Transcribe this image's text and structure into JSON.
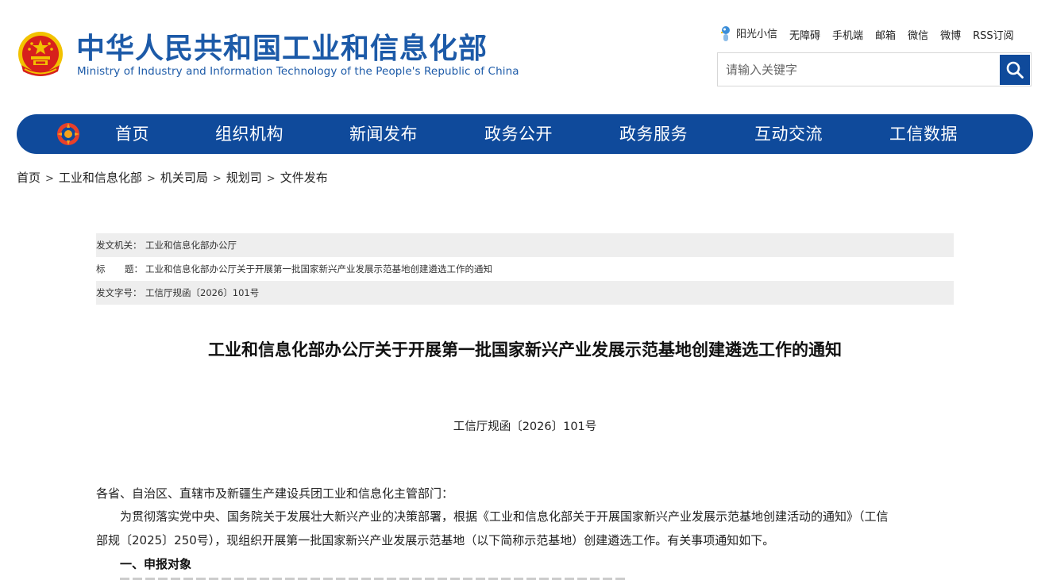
{
  "header": {
    "title": "中华人民共和国工业和信息化部",
    "subtitle": "Ministry of Industry and Information Technology of the People's Republic of China",
    "emblem_icon": "national-emblem-icon",
    "top_links": [
      {
        "label": "阳光小信",
        "icon": "sunshine-mascot-icon"
      },
      {
        "label": "无障碍"
      },
      {
        "label": "手机端"
      },
      {
        "label": "邮箱"
      },
      {
        "label": "微信"
      },
      {
        "label": "微博"
      },
      {
        "label": "RSS订阅"
      }
    ],
    "search": {
      "placeholder": "请输入关键字",
      "icon": "search-icon"
    }
  },
  "nav": {
    "logo_icon": "ministry-logo-icon",
    "items": [
      "首页",
      "组织机构",
      "新闻发布",
      "政务公开",
      "政务服务",
      "互动交流",
      "工信数据"
    ]
  },
  "breadcrumb": [
    "首页",
    "工业和信息化部",
    "机关司局",
    "规划司",
    "文件发布"
  ],
  "meta": {
    "issuer_key": "发文机关：",
    "issuer": "工业和信息化部办公厅",
    "title_key_1": "标",
    "title_key_2": "题：",
    "title": "工业和信息化部办公厅关于开展第一批国家新兴产业发展示范基地创建遴选工作的通知",
    "docno_key": "发文字号：",
    "docno": "工信厅规函〔2026〕101号"
  },
  "article": {
    "title": "工业和信息化部办公厅关于开展第一批国家新兴产业发展示范基地创建遴选工作的通知",
    "doc_number": "工信厅规函〔2026〕101号",
    "salutation": "各省、自治区、直辖市及新疆生产建设兵团工业和信息化主管部门：",
    "para1_line1": "为贯彻落实党中央、国务院关于发展壮大新兴产业的决策部署，根据《工业和信息化部关于开展国家新兴产业发展示范基地创建活动的通知》（工信",
    "para1_line2": "部规〔2025〕250号），现组织开展第一批国家新兴产业发展示范基地（以下简称示范基地）创建遴选工作。有关事项通知如下。",
    "section1": "一、申报对象"
  },
  "colors": {
    "brand_blue": "#0f4a9b",
    "title_blue": "#1c5aa8",
    "emblem_red": "#d7201c",
    "emblem_gold": "#f2c200"
  }
}
